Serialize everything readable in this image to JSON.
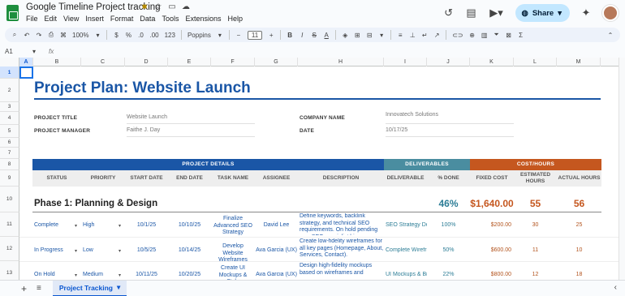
{
  "app": {
    "title": "Google Timeline Project tracking",
    "menu": [
      "File",
      "Edit",
      "View",
      "Insert",
      "Format",
      "Data",
      "Tools",
      "Extensions",
      "Help"
    ],
    "share_label": "Share"
  },
  "toolbar": {
    "zoom": "100%",
    "currency": "$",
    "percent": "%",
    "dec_decrease": ".0",
    "dec_increase": ".00",
    "number_format": "123",
    "font": "Poppins",
    "font_size": "11",
    "minus": "−",
    "plus": "+",
    "bold": "B",
    "italic": "I",
    "strike": "S",
    "text_color": "A",
    "function": "Σ"
  },
  "formula_bar": {
    "cell_ref": "A1",
    "fx": "fx"
  },
  "grid": {
    "columns": [
      "A",
      "B",
      "C",
      "D",
      "E",
      "F",
      "G",
      "H",
      "I",
      "J",
      "K",
      "L",
      "M"
    ],
    "rows": [
      "1",
      "2",
      "3",
      "4",
      "5",
      "6",
      "7",
      "8",
      "9",
      "10",
      "11",
      "12",
      "13"
    ]
  },
  "sheet": {
    "title": "Project Plan: Website Launch",
    "project_title_label": "PROJECT TITLE",
    "project_title_value": "Website Launch",
    "project_manager_label": "PROJECT MANAGER",
    "project_manager_value": "Faithe J. Day",
    "company_label": "COMPANY NAME",
    "company_value": "Innovatech Solutions",
    "date_label": "DATE",
    "date_value": "10/17/25",
    "band_details": "PROJECT DETAILS",
    "band_deliverables": "DELIVERABLES",
    "band_cost": "COST/HOURS",
    "headers": {
      "status": "STATUS",
      "priority": "PRIORITY",
      "start": "START DATE",
      "end": "END DATE",
      "task": "TASK NAME",
      "assignee": "ASSIGNEE",
      "description": "DESCRIPTION",
      "deliverable": "DELIVERABLE",
      "done": "% DONE",
      "fixed": "FIXED COST",
      "est_line1": "ESTIMATED",
      "est_line2": "HOURS",
      "actual": "ACTUAL HOURS"
    },
    "phase": {
      "title": "Phase 1: Planning & Design",
      "done": "46%",
      "cost": "$1,640.00",
      "est": "55",
      "actual": "56"
    },
    "rows": [
      {
        "status": "Complete",
        "priority": "High",
        "start": "10/1/25",
        "end": "10/10/25",
        "task": "Finalize Advanced SEO Strategy",
        "assignee": "David Lee",
        "description": "Define keywords, backlink strategy, and technical SEO requirements. On hold pending new SEO specialist hire.",
        "deliverable": "SEO Strategy Doc",
        "done": "100%",
        "fixed": "$200.00",
        "est": "30",
        "actual": "25"
      },
      {
        "status": "In Progress",
        "priority": "Low",
        "start": "10/5/25",
        "end": "10/14/25",
        "task": "Develop Website Wireframes",
        "assignee": "Ava Garcia (UX)",
        "description": "Create low-fidelity wireframes for all key pages (Homepage, About, Services, Contact).",
        "deliverable": "Complete Wirefra",
        "done": "50%",
        "fixed": "$600.00",
        "est": "11",
        "actual": "10"
      },
      {
        "status": "On Hold",
        "priority": "Medium",
        "start": "10/11/25",
        "end": "10/20/25",
        "task": "Create UI Mockups & Style",
        "assignee": "Ava Garcia (UX)",
        "description": "Design high-fidelity mockups based on wireframes and",
        "deliverable": "UI Mockups & Bra",
        "done": "22%",
        "fixed": "$800.00",
        "est": "12",
        "actual": "18"
      }
    ]
  },
  "tabs": {
    "active": "Project Tracking"
  },
  "icons": {
    "star": "star-icon",
    "history": "history-icon",
    "comment": "comment-icon",
    "meet": "video-icon",
    "gemini": "gemini-icon"
  },
  "colors": {
    "brand_blue": "#1a56a6",
    "deliverables_teal": "#4a8da0",
    "cost_orange": "#c5571f",
    "share_bg": "#c2e7ff"
  }
}
